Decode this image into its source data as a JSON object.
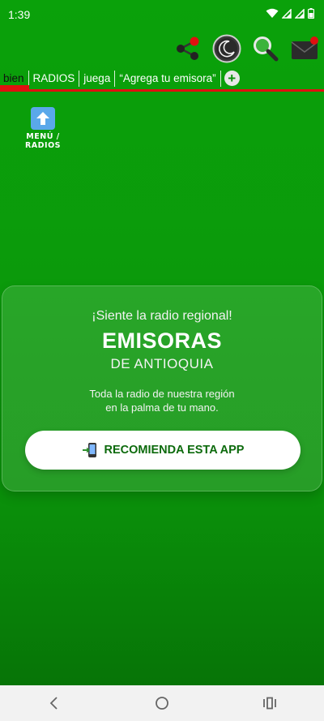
{
  "status_bar": {
    "time": "1:39"
  },
  "toolbar": {
    "icons": [
      "share-icon",
      "night-mode-icon",
      "search-icon",
      "mail-icon"
    ],
    "colors": {
      "badge": "#e01010",
      "accent_green": "#0a9a0a"
    }
  },
  "tabs": [
    {
      "label": "bien"
    },
    {
      "label": "RADIOS"
    },
    {
      "label": "juega"
    },
    {
      "label": "“Agrega tu emisora”"
    }
  ],
  "menu_shortcut": {
    "label": "MENÚ / RADIOS"
  },
  "card": {
    "tagline": "¡Siente la radio regional!",
    "title": "EMISORAS",
    "subtitle": "DE ANTIOQUIA",
    "description_line1": "Toda la radio de nuestra región",
    "description_line2": "en la palma de tu mano.",
    "cta_label": "RECOMIENDA ESTA APP"
  }
}
